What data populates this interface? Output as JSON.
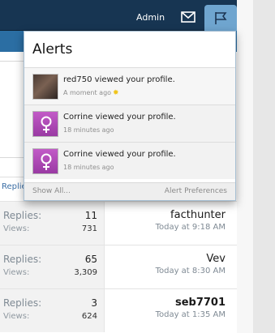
{
  "header": {
    "admin_label": "Admin",
    "icons": {
      "mail": "envelope-icon",
      "alerts": "flag-icon"
    }
  },
  "alerts": {
    "title": "Alerts",
    "items": [
      {
        "message": "red750 viewed your profile.",
        "time": "A moment ago",
        "avatar": "user-photo",
        "new": true
      },
      {
        "message": "Corrine viewed your profile.",
        "time": "18 minutes ago",
        "avatar": "female-symbol-icon",
        "new": false
      },
      {
        "message": "Corrine viewed your profile.",
        "time": "18 minutes ago",
        "avatar": "female-symbol-icon",
        "new": false
      }
    ],
    "show_all": "Show All...",
    "preferences": "Alert Preferences"
  },
  "background": {
    "replies_link": "Replie"
  },
  "threads": [
    {
      "replies_label": "Replies:",
      "replies": "11",
      "views_label": "Views:",
      "views": "731",
      "last_user": "facthunter",
      "last_time": "Today at 9:18 AM",
      "bold": false
    },
    {
      "replies_label": "Replies:",
      "replies": "65",
      "views_label": "Views:",
      "views": "3,309",
      "last_user": "Vev",
      "last_time": "Today at 8:30 AM",
      "bold": false
    },
    {
      "replies_label": "Replies:",
      "replies": "3",
      "views_label": "Views:",
      "views": "624",
      "last_user": "seb7701",
      "last_time": "Today at 1:35 AM",
      "bold": true
    }
  ],
  "colors": {
    "topbar": "#173552",
    "subbar": "#2b6ea3",
    "alerts_tab": "#6fa5cf",
    "female_avatar": "#b24cb8"
  }
}
